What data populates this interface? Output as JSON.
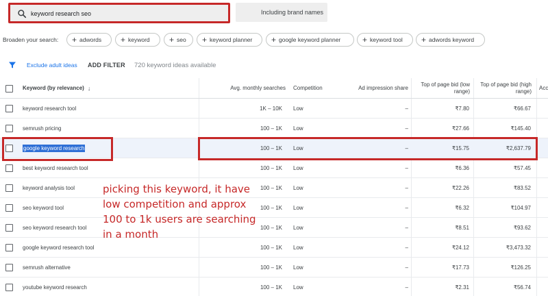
{
  "search": {
    "query": "keyword research seo",
    "brand_filter": "Including brand names"
  },
  "broaden": {
    "label": "Broaden your search:",
    "chips": [
      "adwords",
      "keyword",
      "seo",
      "keyword planner",
      "google keyword planner",
      "keyword tool",
      "adwords keyword"
    ]
  },
  "filter_bar": {
    "exclude_label": "Exclude adult ideas",
    "add_filter_label": "ADD FILTER",
    "ideas_count": "720 keyword ideas available"
  },
  "table": {
    "headers": {
      "keyword": "Keyword (by relevance)",
      "searches": "Avg. monthly searches",
      "competition": "Competition",
      "impression": "Ad impression share",
      "bid_low": "Top of page bid (low range)",
      "bid_high": "Top of page bid (high range)",
      "more": "Acc"
    },
    "rows": [
      {
        "keyword": "keyword research tool",
        "searches": "1K – 10K",
        "competition": "Low",
        "impression": "–",
        "bid_low": "₹7.80",
        "bid_high": "₹66.67"
      },
      {
        "keyword": "semrush pricing",
        "searches": "100 – 1K",
        "competition": "Low",
        "impression": "–",
        "bid_low": "₹27.66",
        "bid_high": "₹145.40"
      },
      {
        "keyword": "google keyword research",
        "searches": "100 – 1K",
        "competition": "Low",
        "impression": "–",
        "bid_low": "₹15.75",
        "bid_high": "₹2,637.79"
      },
      {
        "keyword": "best keyword research tool",
        "searches": "100 – 1K",
        "competition": "Low",
        "impression": "–",
        "bid_low": "₹6.36",
        "bid_high": "₹57.45"
      },
      {
        "keyword": "keyword analysis tool",
        "searches": "100 – 1K",
        "competition": "Low",
        "impression": "–",
        "bid_low": "₹22.26",
        "bid_high": "₹83.52"
      },
      {
        "keyword": "seo keyword tool",
        "searches": "100 – 1K",
        "competition": "Low",
        "impression": "–",
        "bid_low": "₹6.32",
        "bid_high": "₹104.97"
      },
      {
        "keyword": "seo keyword research tool",
        "searches": "100 – 1K",
        "competition": "Low",
        "impression": "–",
        "bid_low": "₹8.51",
        "bid_high": "₹93.62"
      },
      {
        "keyword": "google keyword research tool",
        "searches": "100 – 1K",
        "competition": "Low",
        "impression": "–",
        "bid_low": "₹24.12",
        "bid_high": "₹3,473.32"
      },
      {
        "keyword": "semrush alternative",
        "searches": "100 – 1K",
        "competition": "Low",
        "impression": "–",
        "bid_low": "₹17.73",
        "bid_high": "₹126.25"
      },
      {
        "keyword": "youtube keyword research",
        "searches": "100 – 1K",
        "competition": "Low",
        "impression": "–",
        "bid_low": "₹2.31",
        "bid_high": "₹56.74"
      }
    ],
    "selected_row": 2
  },
  "annotation": "picking this keyword, it have low competition and approx 100 to 1k users are searching in a month",
  "colors": {
    "accent": "#1a73e8",
    "highlight_box": "#c62828",
    "selected_text_bg": "#2e6fd6"
  }
}
